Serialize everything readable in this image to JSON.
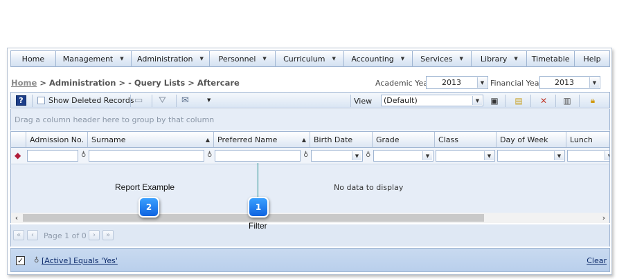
{
  "menu": {
    "items": [
      {
        "label": "Home",
        "dropdown": false
      },
      {
        "label": "Management",
        "dropdown": true
      },
      {
        "label": "Administration",
        "dropdown": true
      },
      {
        "label": "Personnel",
        "dropdown": true
      },
      {
        "label": "Curriculum",
        "dropdown": true
      },
      {
        "label": "Accounting",
        "dropdown": true
      },
      {
        "label": "Services",
        "dropdown": true
      },
      {
        "label": "Library",
        "dropdown": true
      },
      {
        "label": "Timetable",
        "dropdown": false
      },
      {
        "label": "Help",
        "dropdown": false
      }
    ]
  },
  "breadcrumb": {
    "home": "Home",
    "path": " > Administration > - Query Lists > Aftercare"
  },
  "years": {
    "academic_label": "Academic Year",
    "academic_value": "2013",
    "financial_label": "Financial Year",
    "financial_value": "2013"
  },
  "toolbar": {
    "help_icon": "help-icon",
    "show_deleted": "Show Deleted Records",
    "show_deleted_checked": false,
    "view_label": "View",
    "view_value": "(Default)"
  },
  "grid": {
    "group_hint": "Drag a column header here to group by that column",
    "columns": [
      "Admission No.",
      "Surname",
      "Preferred Name",
      "Birth Date",
      "Grade",
      "Class",
      "Day of Week",
      "Lunch"
    ],
    "empty_text": "No data to display"
  },
  "pager": {
    "page_text": "Page 1 of 0"
  },
  "status": {
    "filter_checked": true,
    "filter_text": "[Active] Equals 'Yes'",
    "clear_label": "Clear"
  },
  "callouts": [
    {
      "number": "1",
      "label": "Filter"
    },
    {
      "number": "2",
      "label": "Report Example"
    }
  ],
  "colors": {
    "accent_blue": "#1565e8",
    "border": "#9fb5d2",
    "grid_bg": "#e6edf7",
    "status_bg": "#c4d6ee"
  }
}
